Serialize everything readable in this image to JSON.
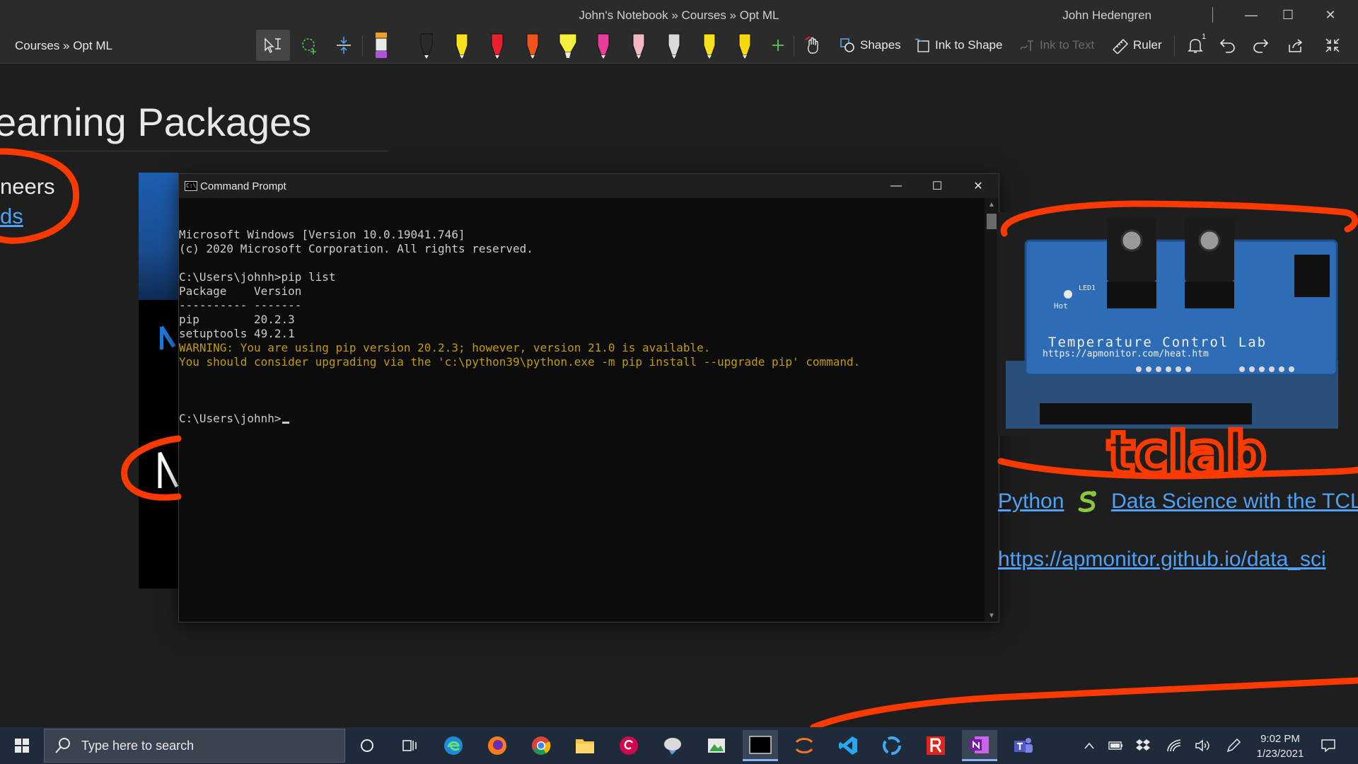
{
  "window": {
    "title": "John's Notebook » Courses » Opt ML",
    "user": "John Hedengren",
    "minimize_glyph": "—",
    "maximize_glyph": "☐",
    "close_glyph": "✕"
  },
  "ribbon": {
    "breadcrumb": "Courses » Opt ML",
    "shapes_label": "Shapes",
    "ink_to_shape_label": "Ink to Shape",
    "ink_to_text_label": "Ink to Text",
    "ruler_label": "Ruler",
    "notification_count": "1",
    "pens": [
      {
        "name": "pen-black",
        "color": "#2a2a2a"
      },
      {
        "name": "pen-yellow",
        "color": "#f5e11e"
      },
      {
        "name": "pen-red",
        "color": "#e8212e"
      },
      {
        "name": "pen-orange-red",
        "color": "#f0541e"
      },
      {
        "name": "highlighter-yellow",
        "color": "#f5f03c"
      },
      {
        "name": "pen-pink",
        "color": "#e83d9a"
      },
      {
        "name": "pen-light-pink",
        "color": "#f3b7c4"
      },
      {
        "name": "pen-galaxy",
        "color": "#d9d9d9"
      },
      {
        "name": "pen-yellow-2",
        "color": "#f5e11e"
      },
      {
        "name": "pen-yellow-3",
        "color": "#f5d90a"
      }
    ],
    "ink_color": "#fc3a00"
  },
  "page": {
    "title": "earning Packages",
    "left_text": "neers",
    "left_link": "ds"
  },
  "cmd": {
    "title": "Command Prompt",
    "icon_text": "C:\\",
    "lines": [
      {
        "text": "Microsoft Windows [Version 10.0.19041.746]",
        "type": "normal"
      },
      {
        "text": "(c) 2020 Microsoft Corporation. All rights reserved.",
        "type": "normal"
      },
      {
        "text": "",
        "type": "normal"
      },
      {
        "text": "C:\\Users\\johnh>pip list",
        "type": "normal"
      },
      {
        "text": "Package    Version",
        "type": "normal"
      },
      {
        "text": "---------- -------",
        "type": "normal"
      },
      {
        "text": "pip        20.2.3",
        "type": "normal"
      },
      {
        "text": "setuptools 49.2.1",
        "type": "normal"
      },
      {
        "text": "WARNING: You are using pip version 20.2.3; however, version 21.0 is available.",
        "type": "warn"
      },
      {
        "text": "You should consider upgrading via the 'c:\\python39\\python.exe -m pip install --upgrade pip' command.",
        "type": "warn"
      },
      {
        "text": "",
        "type": "normal"
      }
    ],
    "prompt": "C:\\Users\\johnh>",
    "warn_color": "#c19c00"
  },
  "right": {
    "board_label": "Temperature Control Lab",
    "board_url": "https://apmonitor.com/heat.htm",
    "board_led": "LED1",
    "board_hot": "Hot",
    "ink_word": "tclab",
    "python_link_a": "Python",
    "python_link_b": "Data Science with the TCLa",
    "url_link": "https://apmonitor.github.io/data_sci"
  },
  "taskbar": {
    "search_placeholder": "Type here to search",
    "time": "9:02 PM",
    "date": "1/23/2021"
  }
}
